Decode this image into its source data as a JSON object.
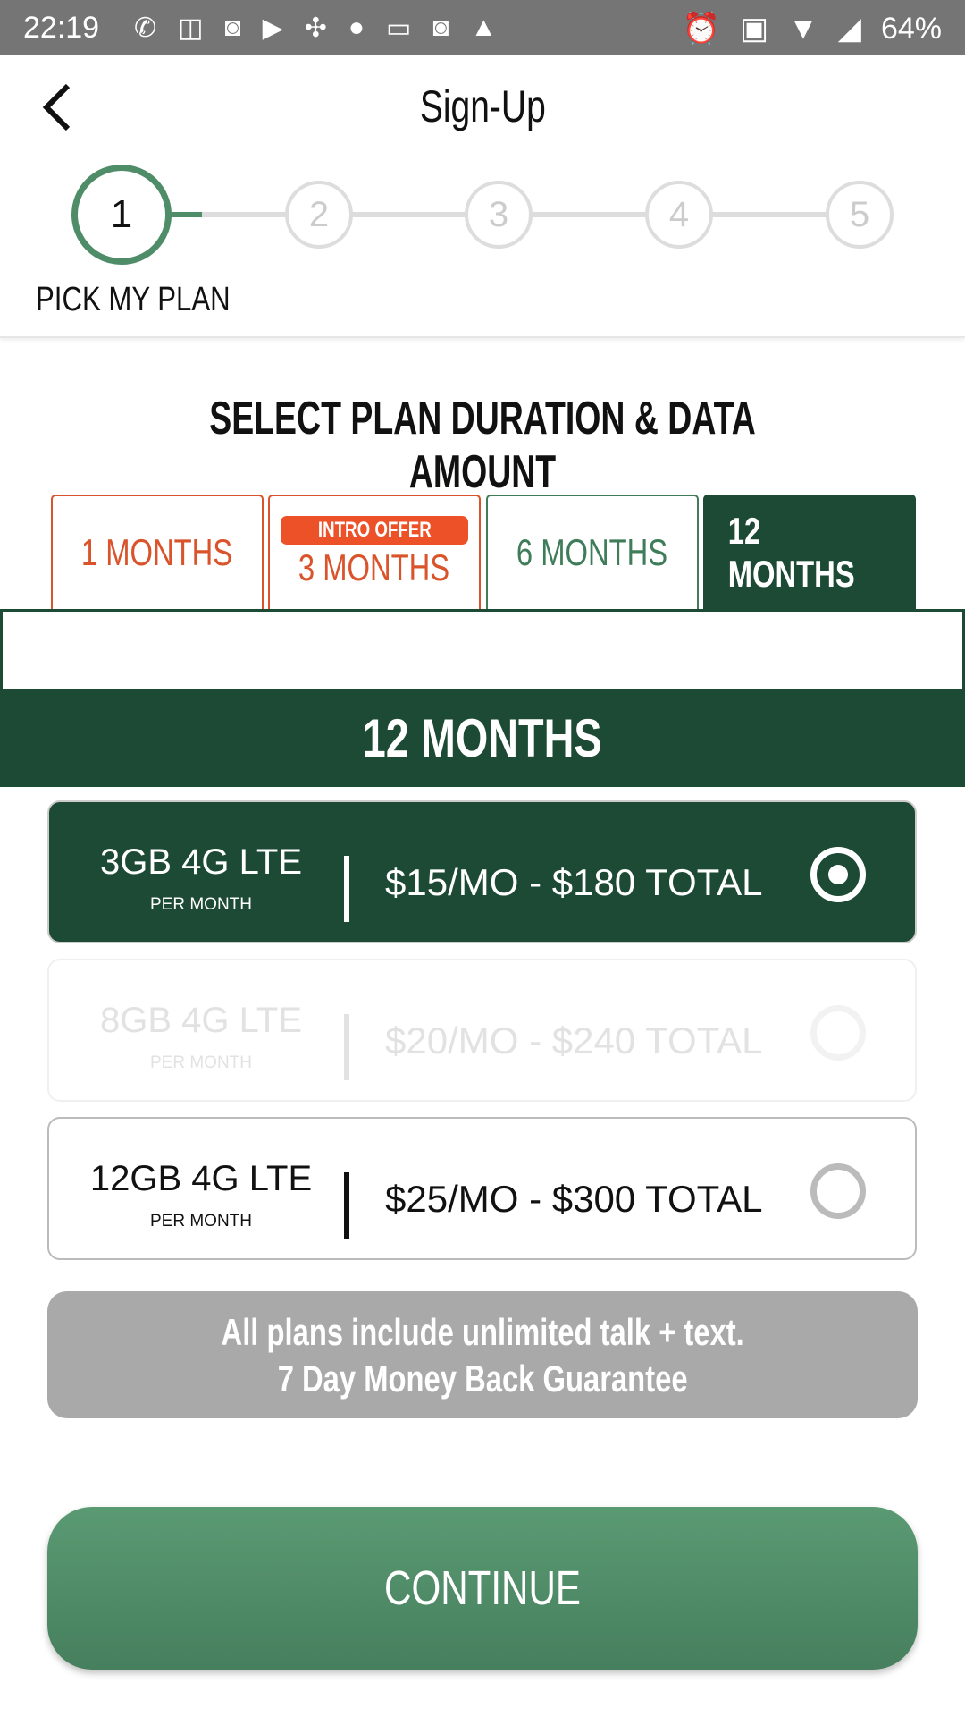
{
  "status_bar": {
    "time": "22:19",
    "battery": "64%",
    "notification_icons": [
      "whatsapp-icon",
      "book-icon",
      "instagram-icon",
      "youtube-icon",
      "pinwheel-icon",
      "apple-icon",
      "http-icon",
      "instagram-icon",
      "gallery-icon"
    ],
    "system_icons": [
      "alarm-icon",
      "cast-icon",
      "wifi-icon",
      "signal-icon"
    ]
  },
  "header": {
    "title": "Sign-Up",
    "back": "‹"
  },
  "stepper": {
    "steps": [
      "1",
      "2",
      "3",
      "4",
      "5"
    ],
    "active_step": 1,
    "active_label": "PICK MY PLAN"
  },
  "heading": "SELECT PLAN DURATION & DATA AMOUNT",
  "tabs": [
    {
      "label": "1 MONTHS"
    },
    {
      "label": "3 MONTHS",
      "badge": "INTRO OFFER"
    },
    {
      "label": "6 MONTHS"
    },
    {
      "label": "12 MONTHS",
      "selected": true
    }
  ],
  "selected_duration": "12 MONTHS",
  "plans": [
    {
      "data": "3GB 4G LTE",
      "per": "PER MONTH",
      "price": "$15/MO - $180 TOTAL",
      "selected": true
    },
    {
      "data": "8GB 4G LTE",
      "per": "PER MONTH",
      "price": "$20/MO - $240 TOTAL",
      "disabled": true
    },
    {
      "data": "12GB 4G LTE",
      "per": "PER MONTH",
      "price": "$25/MO - $300 TOTAL"
    }
  ],
  "info": {
    "line1": "All plans include unlimited talk + text.",
    "line2": "7 Day Money Back Guarantee"
  },
  "continue_label": "CONTINUE",
  "colors": {
    "dark_green": "#1d4a34",
    "green": "#4e8d68",
    "orange": "#ec5128",
    "status_bar": "#757575"
  }
}
